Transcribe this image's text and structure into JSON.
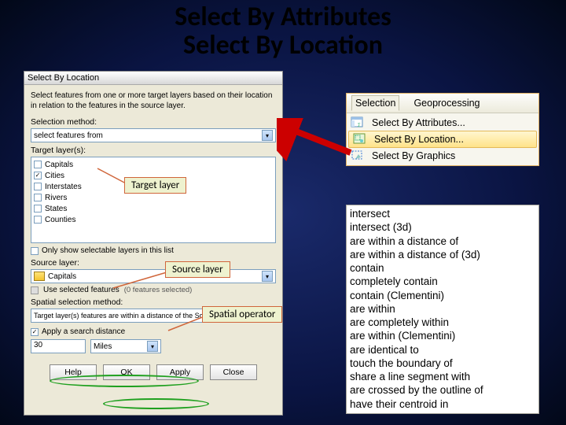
{
  "title": {
    "l1": "Select By Attributes",
    "l2": "Select By Location"
  },
  "dialog": {
    "title": "Select By Location",
    "desc": "Select features from one or more target layers based on their location in relation to the features in the source layer.",
    "selection_method_label": "Selection method:",
    "selection_method_value": "select features from",
    "target_layers_label": "Target layer(s):",
    "layers": [
      {
        "name": "Capitals",
        "checked": false
      },
      {
        "name": "Cities",
        "checked": true
      },
      {
        "name": "Interstates",
        "checked": false
      },
      {
        "name": "Rivers",
        "checked": false
      },
      {
        "name": "States",
        "checked": false
      },
      {
        "name": "Counties",
        "checked": false
      }
    ],
    "only_selectable_label": "Only show selectable layers in this list",
    "source_layer_label": "Source layer:",
    "source_layer_value": "Capitals",
    "use_selected_label": "Use selected features",
    "use_selected_info": "(0 features selected)",
    "spatial_method_label": "Spatial selection method:",
    "spatial_method_value": "Target layer(s) features are within a distance of the Source layer feature",
    "apply_distance_label": "Apply a search distance",
    "distance_value": "30",
    "distance_unit": "Miles",
    "buttons": {
      "help": "Help",
      "ok": "OK",
      "apply": "Apply",
      "close": "Close"
    }
  },
  "callouts": {
    "target": "Target layer",
    "source": "Source layer",
    "spatial": "Spatial operator"
  },
  "menu": {
    "tabs": {
      "selection": "Selection",
      "geoprocessing": "Geoprocessing"
    },
    "items": [
      "Select By Attributes...",
      "Select By Location...",
      "Select By Graphics"
    ],
    "highlighted": 1
  },
  "operators": [
    "intersect",
    "intersect (3d)",
    "are within a distance of",
    "are within a distance of (3d)",
    "contain",
    "completely contain",
    "contain (Clementini)",
    "are within",
    "are completely within",
    "are within (Clementini)",
    "are identical to",
    "touch the boundary of",
    "share a line segment with",
    "are crossed by the outline of",
    "have their centroid in"
  ]
}
